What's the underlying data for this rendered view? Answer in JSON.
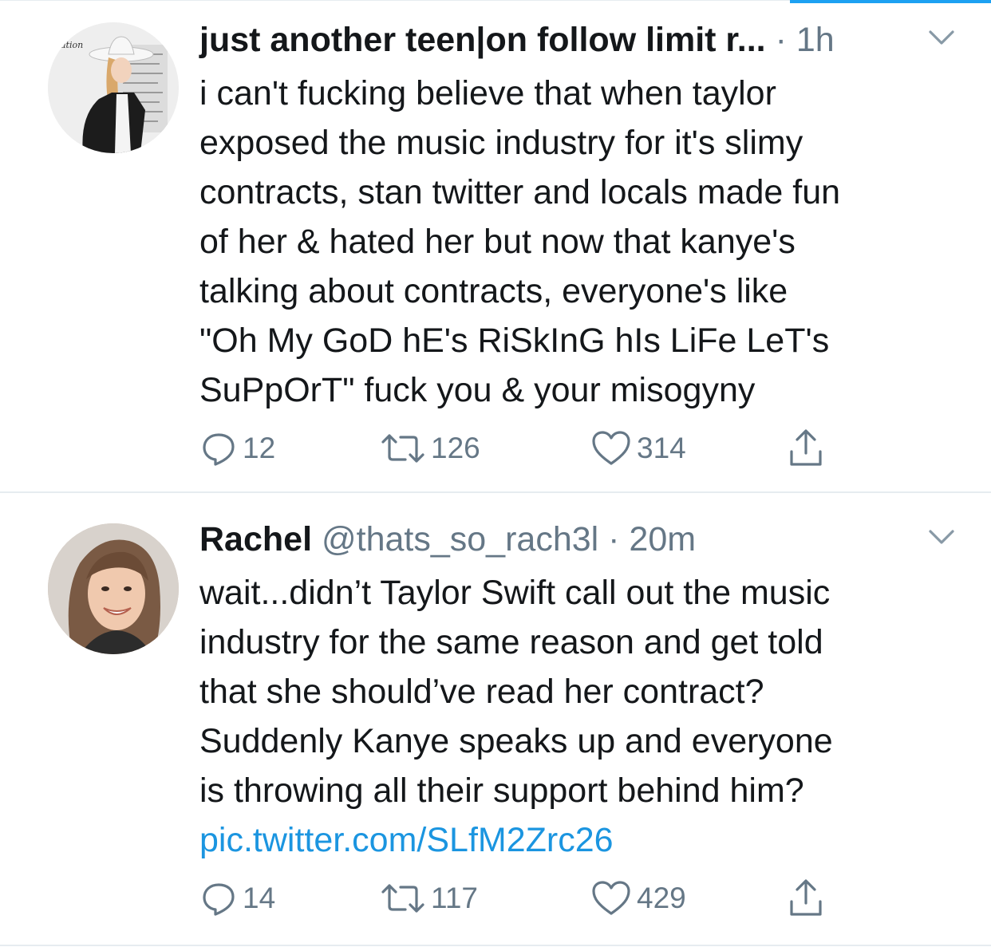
{
  "tweets": [
    {
      "display_name": "just another teen|on follow limit r...",
      "handle": "",
      "time": "1h",
      "text_lines": [
        "i can't fucking believe that when taylor",
        "exposed the music industry for it's slimy",
        "contracts, stan twitter and locals made fun",
        "of her & hated her but now that kanye's",
        "talking about contracts, everyone's like",
        "\"Oh My GoD hE's RiSkInG hIs LiFe LeT's",
        "SuPpOrT\" fuck you & your misogyny"
      ],
      "link": "",
      "replies": "12",
      "retweets": "126",
      "likes": "314",
      "avatar_text": "ation"
    },
    {
      "display_name": "Rachel",
      "handle": "@thats_so_rach3l",
      "time": "20m",
      "text_lines": [
        "wait...didn’t Taylor Swift call out the music",
        "industry for the same reason and get told",
        "that she should’ve read her contract?",
        "Suddenly Kanye speaks up and everyone",
        "is throwing all their support behind him?"
      ],
      "link": "pic.twitter.com/SLfM2Zrc26",
      "replies": "14",
      "retweets": "117",
      "likes": "429"
    }
  ],
  "icons": {
    "reply": "reply-icon",
    "retweet": "retweet-icon",
    "like": "heart-icon",
    "share": "share-icon",
    "more": "chevron-down-icon"
  },
  "colors": {
    "accent": "#1da1f2",
    "link": "#1b95e0",
    "secondary_text": "#657786",
    "divider": "#e6ecf0"
  }
}
